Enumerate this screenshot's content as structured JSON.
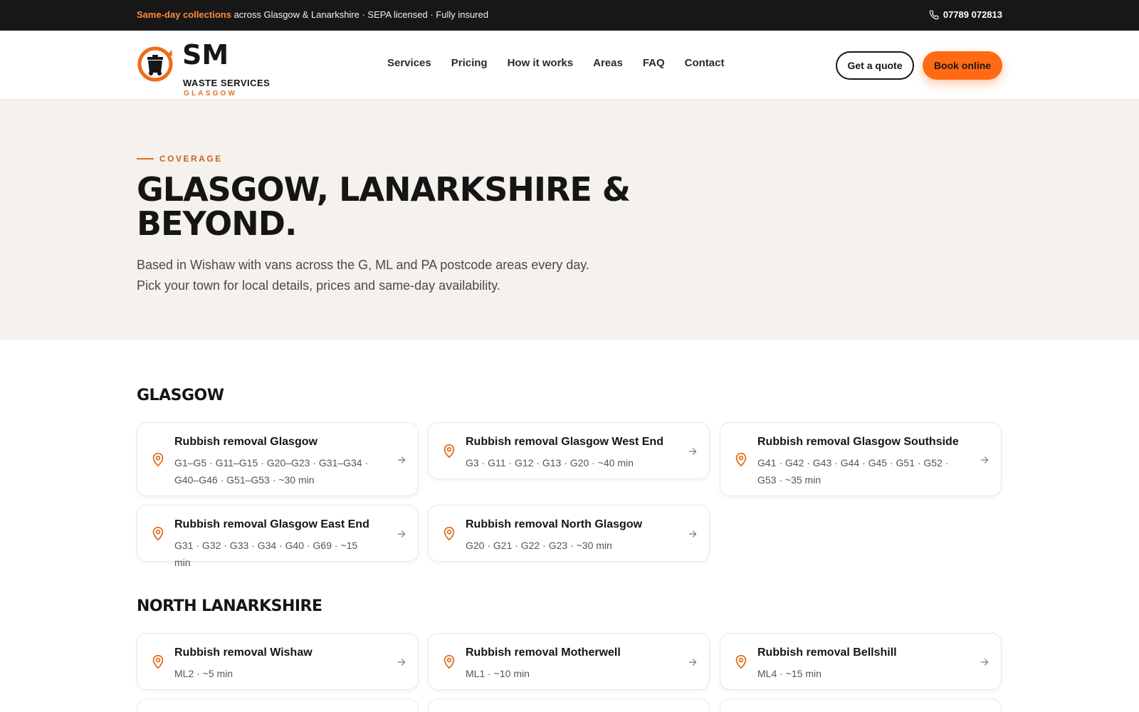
{
  "topbar": {
    "promo_highlight": "Same-day collections",
    "promo_rest": " across Glasgow & Lanarkshire · SEPA licensed · Fully insured",
    "phone": "07789 072813"
  },
  "logo": {
    "line1": "SM",
    "line2": "WASTE SERVICES",
    "line3": "GLASGOW"
  },
  "nav": [
    "Services",
    "Pricing",
    "How it works",
    "Areas",
    "FAQ",
    "Contact"
  ],
  "buttons": {
    "quote": "Get a quote",
    "book": "Book online"
  },
  "hero": {
    "eyebrow": "COVERAGE",
    "title": "GLASGOW, LANARKSHIRE & BEYOND.",
    "subtitle": "Based in Wishaw with vans across the G, ML and PA postcode areas every day. Pick your town for local details, prices and same-day availability."
  },
  "sections": [
    {
      "title": "GLASGOW",
      "cards": [
        {
          "title": "Rubbish removal Glasgow",
          "meta": "G1–G5 · G11–G15 · G20–G23 · G31–G34 · G40–G46 · G51–G53 · ~30 min"
        },
        {
          "title": "Rubbish removal Glasgow West End",
          "meta": "G3 · G11 · G12 · G13 · G20 · ~40 min"
        },
        {
          "title": "Rubbish removal Glasgow Southside",
          "meta": "G41 · G42 · G43 · G44 · G45 · G51 · G52 · G53 · ~35 min"
        },
        {
          "title": "Rubbish removal Glasgow East End",
          "meta": "G31 · G32 · G33 · G34 · G40 · G69 · ~15 min"
        },
        {
          "title": "Rubbish removal North Glasgow",
          "meta": "G20 · G21 · G22 · G23 · ~30 min"
        }
      ]
    },
    {
      "title": "NORTH LANARKSHIRE",
      "cards": [
        {
          "title": "Rubbish removal Wishaw",
          "meta": "ML2 · ~5 min"
        },
        {
          "title": "Rubbish removal Motherwell",
          "meta": "ML1 · ~10 min"
        },
        {
          "title": "Rubbish removal Bellshill",
          "meta": "ML4 · ~15 min"
        }
      ]
    }
  ],
  "colors": {
    "accent": "#ff6a13",
    "topbar_bg": "#171717",
    "hero_bg": "#f5f1ec"
  },
  "icons": {
    "phone": "phone-icon",
    "pin": "map-pin-icon",
    "arrow": "arrow-right-icon",
    "logo": "wheelie-bin-logo-icon"
  }
}
